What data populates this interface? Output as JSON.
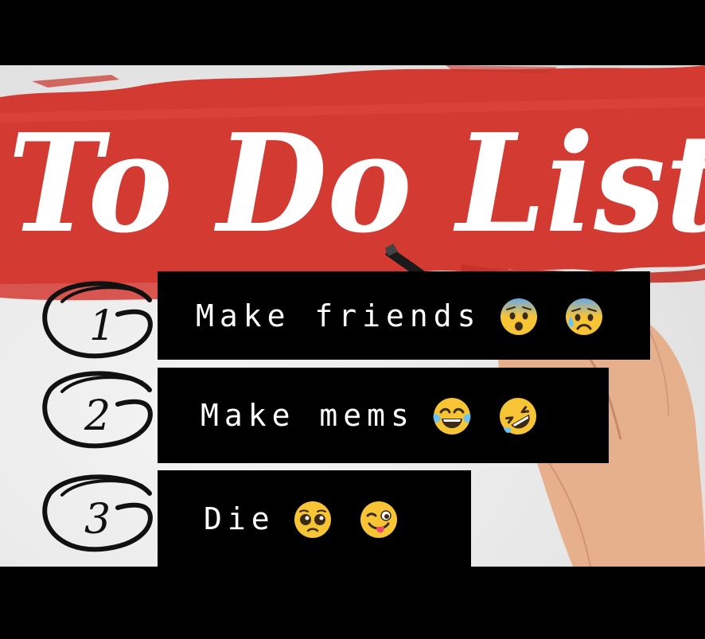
{
  "title": "To Do List",
  "items": [
    {
      "number": "1",
      "text": "Make friends",
      "emoji_icons": [
        "anxious-face-icon",
        "anxious-sweat-face-icon"
      ]
    },
    {
      "number": "2",
      "text": "Make mems",
      "emoji_icons": [
        "tears-of-joy-face-icon",
        "rolling-laughing-face-icon"
      ]
    },
    {
      "number": "3",
      "text": "Die",
      "emoji_icons": [
        "pleading-face-icon",
        "winking-tongue-face-icon"
      ]
    }
  ],
  "colors": {
    "brush_red": "#d33b32",
    "title_white": "#ffffff",
    "bar_black": "#000000",
    "emoji_yellow": "#f7c436"
  }
}
